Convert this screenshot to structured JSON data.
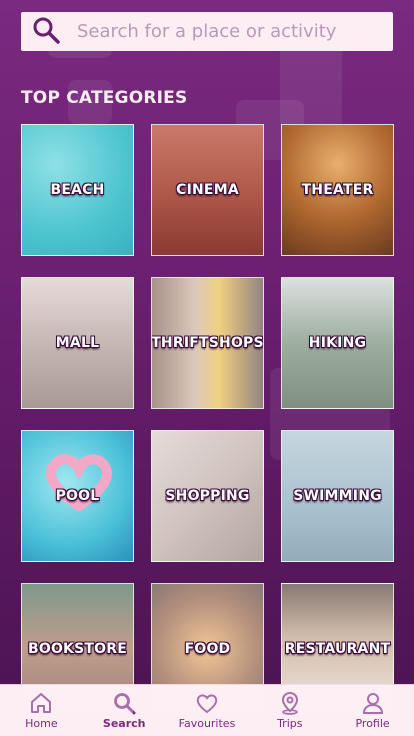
{
  "search": {
    "placeholder": "Search for a place or activity"
  },
  "section": {
    "title": "TOP CATEGORIES"
  },
  "categories": [
    {
      "label": "BEACH"
    },
    {
      "label": "CINEMA"
    },
    {
      "label": "THEATER"
    },
    {
      "label": "MALL"
    },
    {
      "label": "THRIFTSHOPS"
    },
    {
      "label": "HIKING"
    },
    {
      "label": "POOL"
    },
    {
      "label": "SHOPPING"
    },
    {
      "label": "SWIMMING"
    },
    {
      "label": "BOOKSTORE"
    },
    {
      "label": "FOOD"
    },
    {
      "label": "RESTAURANT"
    }
  ],
  "nav": {
    "home": "Home",
    "search": "Search",
    "favourites": "Favourites",
    "trips": "Trips",
    "profile": "Profile"
  },
  "colors": {
    "accent": "#7a2a80",
    "surface": "#fdeef3"
  }
}
